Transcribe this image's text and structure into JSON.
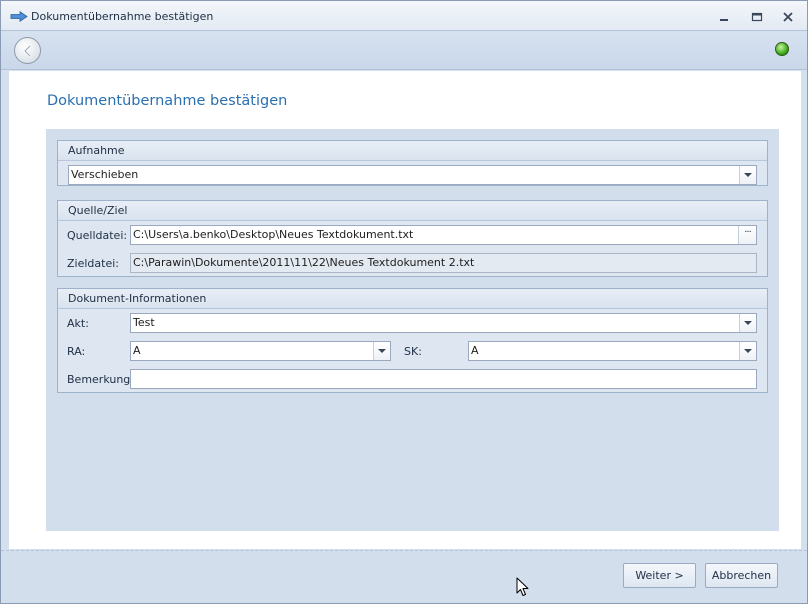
{
  "window": {
    "title": "Dokumentübernahme bestätigen"
  },
  "page": {
    "title": "Dokumentübernahme bestätigen"
  },
  "aufnahme": {
    "header": "Aufnahme",
    "value": "Verschieben"
  },
  "quelle_ziel": {
    "header": "Quelle/Ziel",
    "quelldatei_label": "Quelldatei:",
    "quelldatei_value": "C:\\Users\\a.benko\\Desktop\\Neues Textdokument.txt",
    "zieldatei_label": "Zieldatei:",
    "zieldatei_value": "C:\\Parawin\\Dokumente\\2011\\11\\22\\Neues Textdokument 2.txt"
  },
  "dokument_info": {
    "header": "Dokument-Informationen",
    "akt_label": "Akt:",
    "akt_value": "Test",
    "ra_label": "RA:",
    "ra_value": "A",
    "sk_label": "SK:",
    "sk_value": "A",
    "bemerkung_label": "Bemerkung:",
    "bemerkung_value": ""
  },
  "footer": {
    "next_label": "Weiter >",
    "cancel_label": "Abbrechen"
  },
  "colors": {
    "accent_title": "#2a6fb0",
    "status_led": "#3faa1c",
    "panel_background": "#d3deec"
  },
  "icons": {
    "title": "arrow-right-icon",
    "back": "back-arrow-icon",
    "status": "status-led-icon"
  }
}
